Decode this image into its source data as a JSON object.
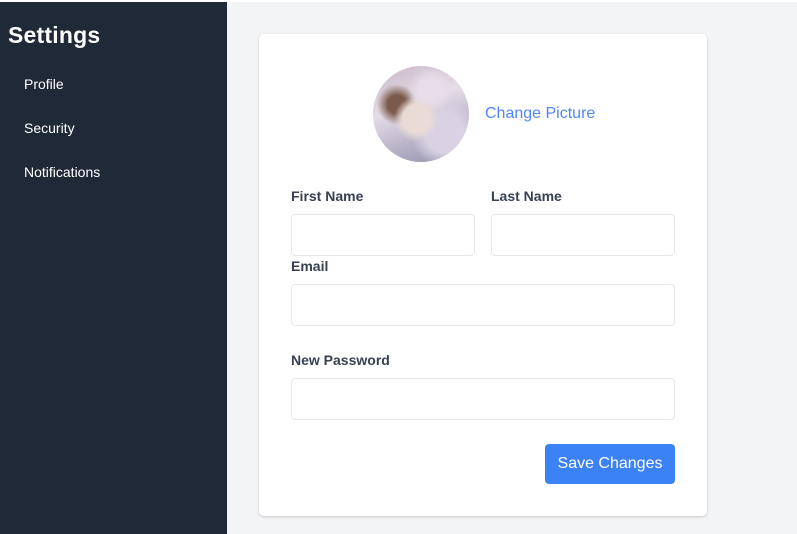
{
  "sidebar": {
    "title": "Settings",
    "items": [
      {
        "label": "Profile"
      },
      {
        "label": "Security"
      },
      {
        "label": "Notifications"
      }
    ]
  },
  "profile": {
    "avatar_icon": "user-photo",
    "change_picture_label": "Change Picture",
    "fields": {
      "first_name": {
        "label": "First Name",
        "value": "",
        "placeholder": ""
      },
      "last_name": {
        "label": "Last Name",
        "value": "",
        "placeholder": ""
      },
      "email": {
        "label": "Email",
        "value": "",
        "placeholder": ""
      },
      "new_password": {
        "label": "New Password",
        "value": "",
        "placeholder": ""
      }
    },
    "save_label": "Save Changes"
  },
  "colors": {
    "sidebar_bg": "#1f2937",
    "accent": "#3b82f6",
    "link": "#4f86f7",
    "page_bg": "#f3f4f6"
  }
}
